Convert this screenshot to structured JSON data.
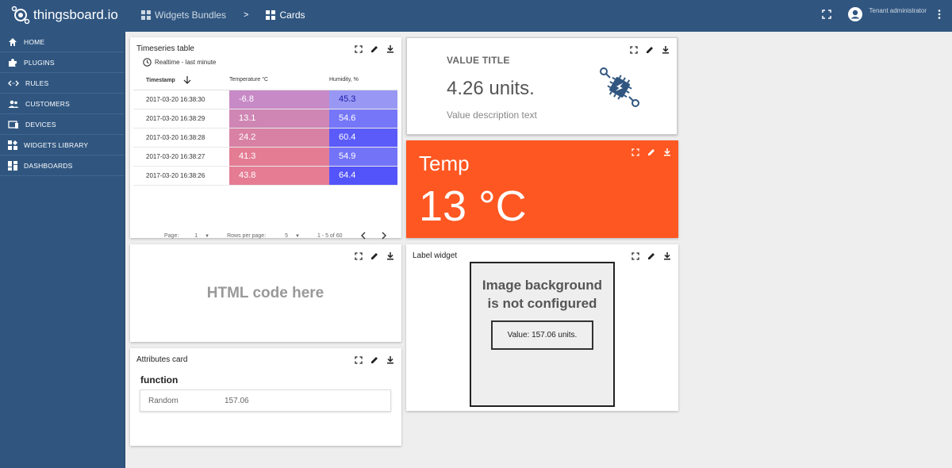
{
  "app": {
    "name": "thingsboard.io"
  },
  "breadcrumb": {
    "bundles": "Widgets Bundles",
    "separator": ">",
    "current": "Cards"
  },
  "user": {
    "role": "Tenant administrator"
  },
  "nav": {
    "items": [
      {
        "label": "HOME",
        "icon": "home-icon"
      },
      {
        "label": "PLUGINS",
        "icon": "puzzle-icon"
      },
      {
        "label": "RULES",
        "icon": "code-arrows-icon"
      },
      {
        "label": "CUSTOMERS",
        "icon": "people-icon"
      },
      {
        "label": "DEVICES",
        "icon": "devices-icon"
      },
      {
        "label": "WIDGETS LIBRARY",
        "icon": "widgets-icon"
      },
      {
        "label": "DASHBOARDS",
        "icon": "dashboard-icon"
      }
    ]
  },
  "timeseries": {
    "title": "Timeseries table",
    "subtitle": "Realtime - last minute",
    "columns": [
      "Timestamp",
      "Temperature °C",
      "Humidity, %"
    ],
    "rows": [
      {
        "ts": "2017-03-20 16:38:30",
        "temp": "-6.8",
        "hum": "45.3"
      },
      {
        "ts": "2017-03-20 16:38:29",
        "temp": "13.1",
        "hum": "54.6"
      },
      {
        "ts": "2017-03-20 16:38:28",
        "temp": "24.2",
        "hum": "60.4"
      },
      {
        "ts": "2017-03-20 16:38:27",
        "temp": "41.3",
        "hum": "54.9"
      },
      {
        "ts": "2017-03-20 16:38:26",
        "temp": "43.8",
        "hum": "64.4"
      }
    ],
    "pager": {
      "page_label": "Page:",
      "page": "1",
      "rows_label": "Rows per page:",
      "rows": "5",
      "range": "1 - 5 of 60"
    }
  },
  "value_card": {
    "title": "VALUE TITLE",
    "value": "4.26 units.",
    "description": "Value description text"
  },
  "temp_card": {
    "title": "Temp",
    "value": "13 °C",
    "color": "#ff5722"
  },
  "html_card": {
    "text": "HTML code here"
  },
  "attributes": {
    "title": "Attributes card",
    "group": "function",
    "key": "Random",
    "value": "157.06"
  },
  "label_widget": {
    "title": "Label widget",
    "message_line1": "Image background",
    "message_line2": "is not configured",
    "value": "Value: 157.06 units."
  },
  "colors": {
    "primary": "#305680",
    "temp_rows": [
      "#c78ac6",
      "#cf86b4",
      "#d981a5",
      "#e47c94",
      "#e57c93"
    ],
    "hum_rows": [
      "#9898f4",
      "#7676f8",
      "#5b5bfa",
      "#7373f8",
      "#5454fb"
    ]
  }
}
